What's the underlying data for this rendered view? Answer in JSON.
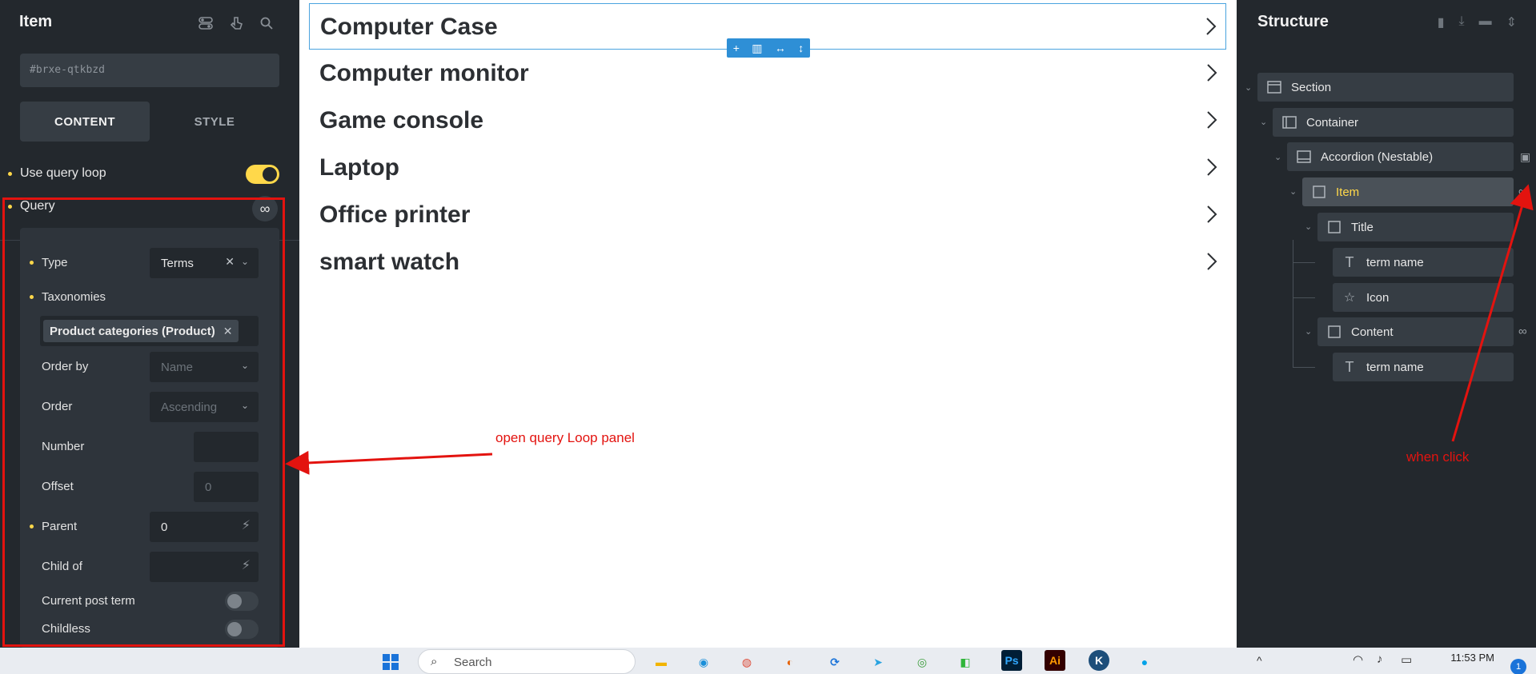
{
  "left_panel": {
    "title": "Item",
    "element_id": "#brxe-qtkbzd",
    "tabs": [
      "CONTENT",
      "STYLE"
    ],
    "use_query_loop_label": "Use query loop",
    "query_label": "Query",
    "query_icon": "∞",
    "query": {
      "type_label": "Type",
      "type_value": "Terms",
      "taxonomies_label": "Taxonomies",
      "taxonomy_chip": "Product categories (Product)",
      "order_by_label": "Order by",
      "order_by_placeholder": "Name",
      "order_label": "Order",
      "order_placeholder": "Ascending",
      "number_label": "Number",
      "offset_label": "Offset",
      "offset_placeholder": "0",
      "parent_label": "Parent",
      "parent_value": "0",
      "child_of_label": "Child of",
      "current_post_term_label": "Current post term",
      "childless_label": "Childless"
    }
  },
  "annotations": {
    "left_note": "open query Loop panel",
    "right_note": "when click"
  },
  "canvas": {
    "items": [
      "Computer Case",
      "Computer monitor",
      "Game console",
      "Laptop",
      "Office printer",
      "smart watch"
    ]
  },
  "structure": {
    "title": "Structure",
    "nodes": {
      "section": "Section",
      "container": "Container",
      "accordion": "Accordion (Nestable)",
      "item": "Item",
      "title": "Title",
      "term_name_1": "term name",
      "icon": "Icon",
      "content": "Content",
      "term_name_2": "term name"
    }
  },
  "taskbar": {
    "search_label": "Search",
    "clock": "11:53 PM",
    "notification_count": "1",
    "app_ps": "Ps",
    "app_ai": "Ai",
    "app_k": "K"
  },
  "colors": {
    "accent_yellow": "#ffd84a",
    "annotation_red": "#e3130f",
    "selection_blue": "#4aa3df",
    "panel_bg": "#23282d"
  }
}
